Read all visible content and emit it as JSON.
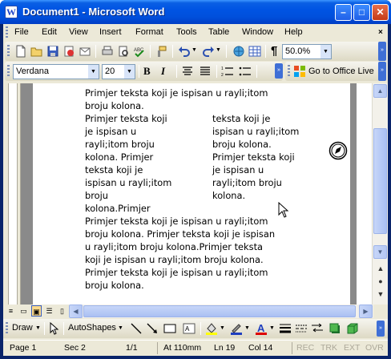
{
  "window": {
    "title": "Document1 - Microsoft Word",
    "app_icon_letter": "W",
    "minimize": "–",
    "maximize": "□",
    "close": "✕"
  },
  "menubar": {
    "items": [
      "File",
      "Edit",
      "View",
      "Insert",
      "Format",
      "Tools",
      "Table",
      "Window",
      "Help"
    ],
    "doc_close": "×"
  },
  "toolbar": {
    "zoom": "50.0%",
    "font_name": "Verdana",
    "font_size": "20",
    "bold": "B",
    "italic": "I",
    "paragraph_mark": "¶",
    "go_to_office_live": "Go to Office Live"
  },
  "document": {
    "line_top_a": "Primjer teksta koji je ispisan u rayli;itom",
    "line_top_b": "broju kolona.",
    "left_col": [
      "Primjer teksta koji",
      "je ispisan u",
      "rayli;itom broju",
      "kolona. Primjer",
      "teksta koji je",
      "ispisan u rayli;itom",
      "broju",
      "kolona.Primjer"
    ],
    "right_col": [
      "teksta koji je",
      "ispisan u rayli;itom",
      "broju kolona.",
      "Primjer teksta koji",
      "je ispisan u",
      "rayli;itom broju",
      "kolona."
    ],
    "bottom": [
      "Primjer teksta koji je ispisan u rayli;itom",
      "broju kolona. Primjer teksta koji je ispisan",
      "u rayli;itom broju kolona.Primjer teksta",
      "koji je ispisan u rayli;itom broju kolona.",
      "Primjer teksta koji je ispisan u rayli;itom",
      "broju kolona."
    ]
  },
  "drawbar": {
    "draw": "Draw",
    "autoshapes": "AutoShapes"
  },
  "status": {
    "page": "Page 1",
    "sec": "Sec 2",
    "page_of": "1/1",
    "at": "At 110mm",
    "ln": "Ln 19",
    "col": "Col 14",
    "rec": "REC",
    "trk": "TRK",
    "ext": "EXT",
    "ovr": "OVR"
  }
}
